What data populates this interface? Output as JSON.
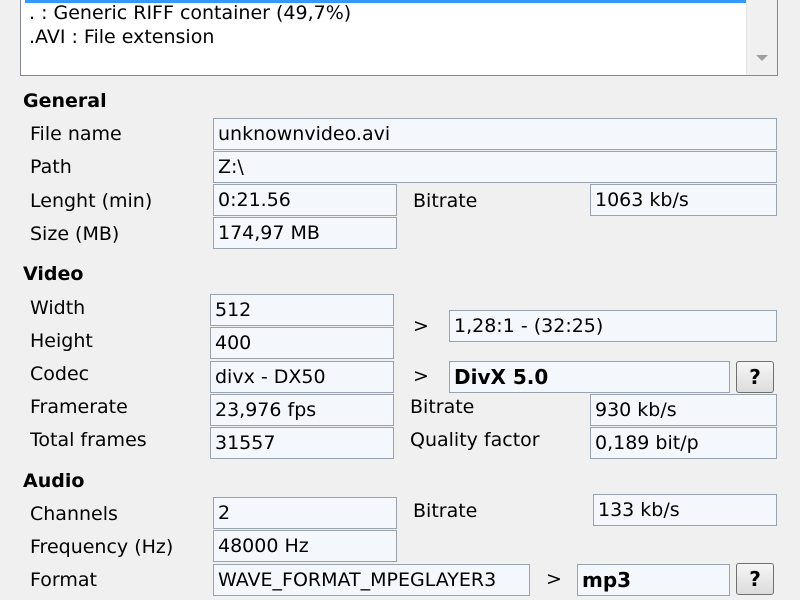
{
  "format_list": {
    "items": [
      ". : Generic RIFF container (49,7%)",
      ".AVI : File extension"
    ]
  },
  "general": {
    "title": "General",
    "file_name_label": "File name",
    "file_name": "unknownvideo.avi",
    "path_label": "Path",
    "path": "Z:\\",
    "length_label": "Lenght (min)",
    "length": "0:21.56",
    "bitrate_label": "Bitrate",
    "bitrate": "1063 kb/s",
    "size_label": "Size (MB)",
    "size": "174,97 MB"
  },
  "video": {
    "title": "Video",
    "width_label": "Width",
    "width": "512",
    "height_label": "Height",
    "height": "400",
    "aspect_arrow": ">",
    "aspect": "1,28:1 - (32:25)",
    "codec_label": "Codec",
    "codec": "divx - DX50",
    "codec_arrow": ">",
    "codec_name": "DivX 5.0",
    "codec_help": "?",
    "framerate_label": "Framerate",
    "framerate": "23,976 fps",
    "bitrate_label": "Bitrate",
    "bitrate": "930 kb/s",
    "total_frames_label": "Total frames",
    "total_frames": "31557",
    "quality_label": "Quality factor",
    "quality": "0,189 bit/p"
  },
  "audio": {
    "title": "Audio",
    "channels_label": "Channels",
    "channels": "2",
    "bitrate_label": "Bitrate",
    "bitrate": "133 kb/s",
    "frequency_label": "Frequency (Hz)",
    "frequency": "48000 Hz",
    "format_label": "Format",
    "format": "WAVE_FORMAT_MPEGLAYER3",
    "format_arrow": ">",
    "format_name": "mp3",
    "format_help": "?"
  },
  "colors": {
    "selection": "#3399ff",
    "field_bg": "#f4f7fc",
    "window_bg": "#f0f0f0"
  }
}
